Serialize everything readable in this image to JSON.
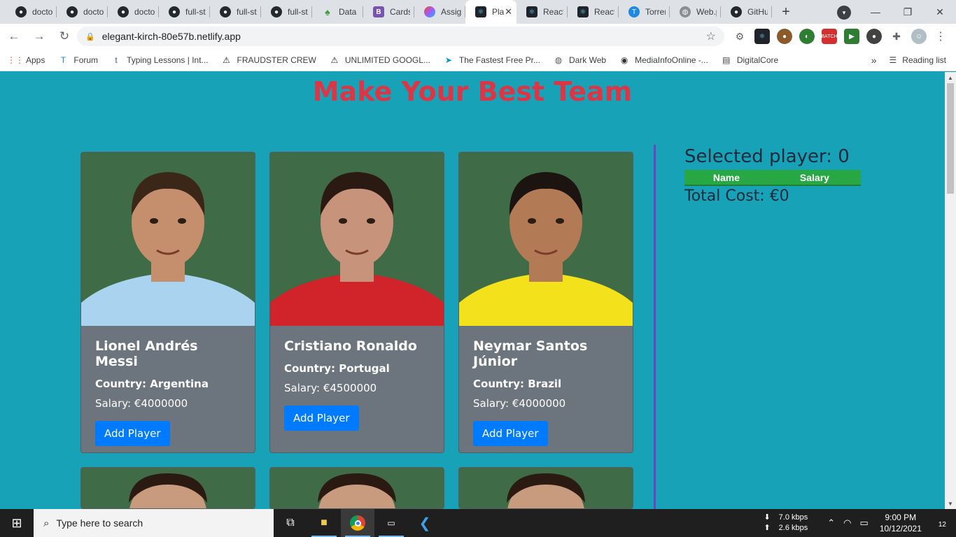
{
  "browser": {
    "tabs": [
      {
        "title": "doctor",
        "icon": "github-icon",
        "active": false
      },
      {
        "title": "doctor",
        "icon": "github-icon",
        "active": false
      },
      {
        "title": "doctor",
        "icon": "github-icon",
        "active": false
      },
      {
        "title": "full-st",
        "icon": "github-icon",
        "active": false
      },
      {
        "title": "full-st",
        "icon": "github-icon",
        "active": false
      },
      {
        "title": "full-st",
        "icon": "github-icon",
        "active": false
      },
      {
        "title": "Data |",
        "icon": "leaf-icon",
        "active": false
      },
      {
        "title": "Cards",
        "icon": "bootstrap-icon",
        "active": false
      },
      {
        "title": "Assign",
        "icon": "figma-icon",
        "active": false
      },
      {
        "title": "Pla",
        "icon": "react-icon",
        "active": true
      },
      {
        "title": "React",
        "icon": "react-icon",
        "active": false
      },
      {
        "title": "React",
        "icon": "react-icon",
        "active": false
      },
      {
        "title": "Torren",
        "icon": "torrent-icon",
        "active": false
      },
      {
        "title": "Web.p",
        "icon": "globe-icon",
        "active": false
      },
      {
        "title": "GitHu",
        "icon": "github-icon",
        "active": false
      }
    ],
    "url": "elegant-kirch-80e57b.netlify.app",
    "bookmarks": [
      {
        "label": "Apps",
        "icon": "apps-grid-icon"
      },
      {
        "label": "Forum",
        "icon": "forum-icon"
      },
      {
        "label": "Typing Lessons | Int...",
        "icon": "typing-icon"
      },
      {
        "label": "FRAUDSTER CREW",
        "icon": "warning-icon"
      },
      {
        "label": "UNLIMITED GOOGL...",
        "icon": "warning-icon"
      },
      {
        "label": "The Fastest Free Pr...",
        "icon": "arrow-icon"
      },
      {
        "label": "Dark Web",
        "icon": "globe-icon"
      },
      {
        "label": "MediaInfoOnline -...",
        "icon": "media-icon"
      },
      {
        "label": "DigitalCore",
        "icon": "server-icon"
      }
    ],
    "reading_list": "Reading list"
  },
  "page": {
    "title": "Make Your Best Team",
    "players": [
      {
        "name": "Lionel Andrés Messi",
        "country": "Country: Argentina",
        "salary": "Salary: €4000000",
        "button": "Add Player",
        "shirt": "#a9d3ee",
        "skin": "#c58f6e",
        "hair": "#3b2718"
      },
      {
        "name": "Cristiano Ronaldo",
        "country": "Country: Portugal",
        "salary": "Salary: €4500000",
        "button": "Add Player",
        "shirt": "#d0232a",
        "skin": "#c7937a",
        "hair": "#2a1a12"
      },
      {
        "name": "Neymar Santos Júnior",
        "country": "Country: Brazil",
        "salary": "Salary: €4000000",
        "button": "Add Player",
        "shirt": "#f3e21b",
        "skin": "#b27a55",
        "hair": "#1c1410"
      }
    ],
    "summary": {
      "selected": "Selected player: 0",
      "col_name": "Name",
      "col_salary": "Salary",
      "total": "Total Cost: €0"
    }
  },
  "taskbar": {
    "search_placeholder": "Type here to search",
    "down_speed": "7.0 kbps",
    "up_speed": "2.6 kbps",
    "time": "9:00 PM",
    "date": "10/12/2021",
    "notifications": "12"
  }
}
